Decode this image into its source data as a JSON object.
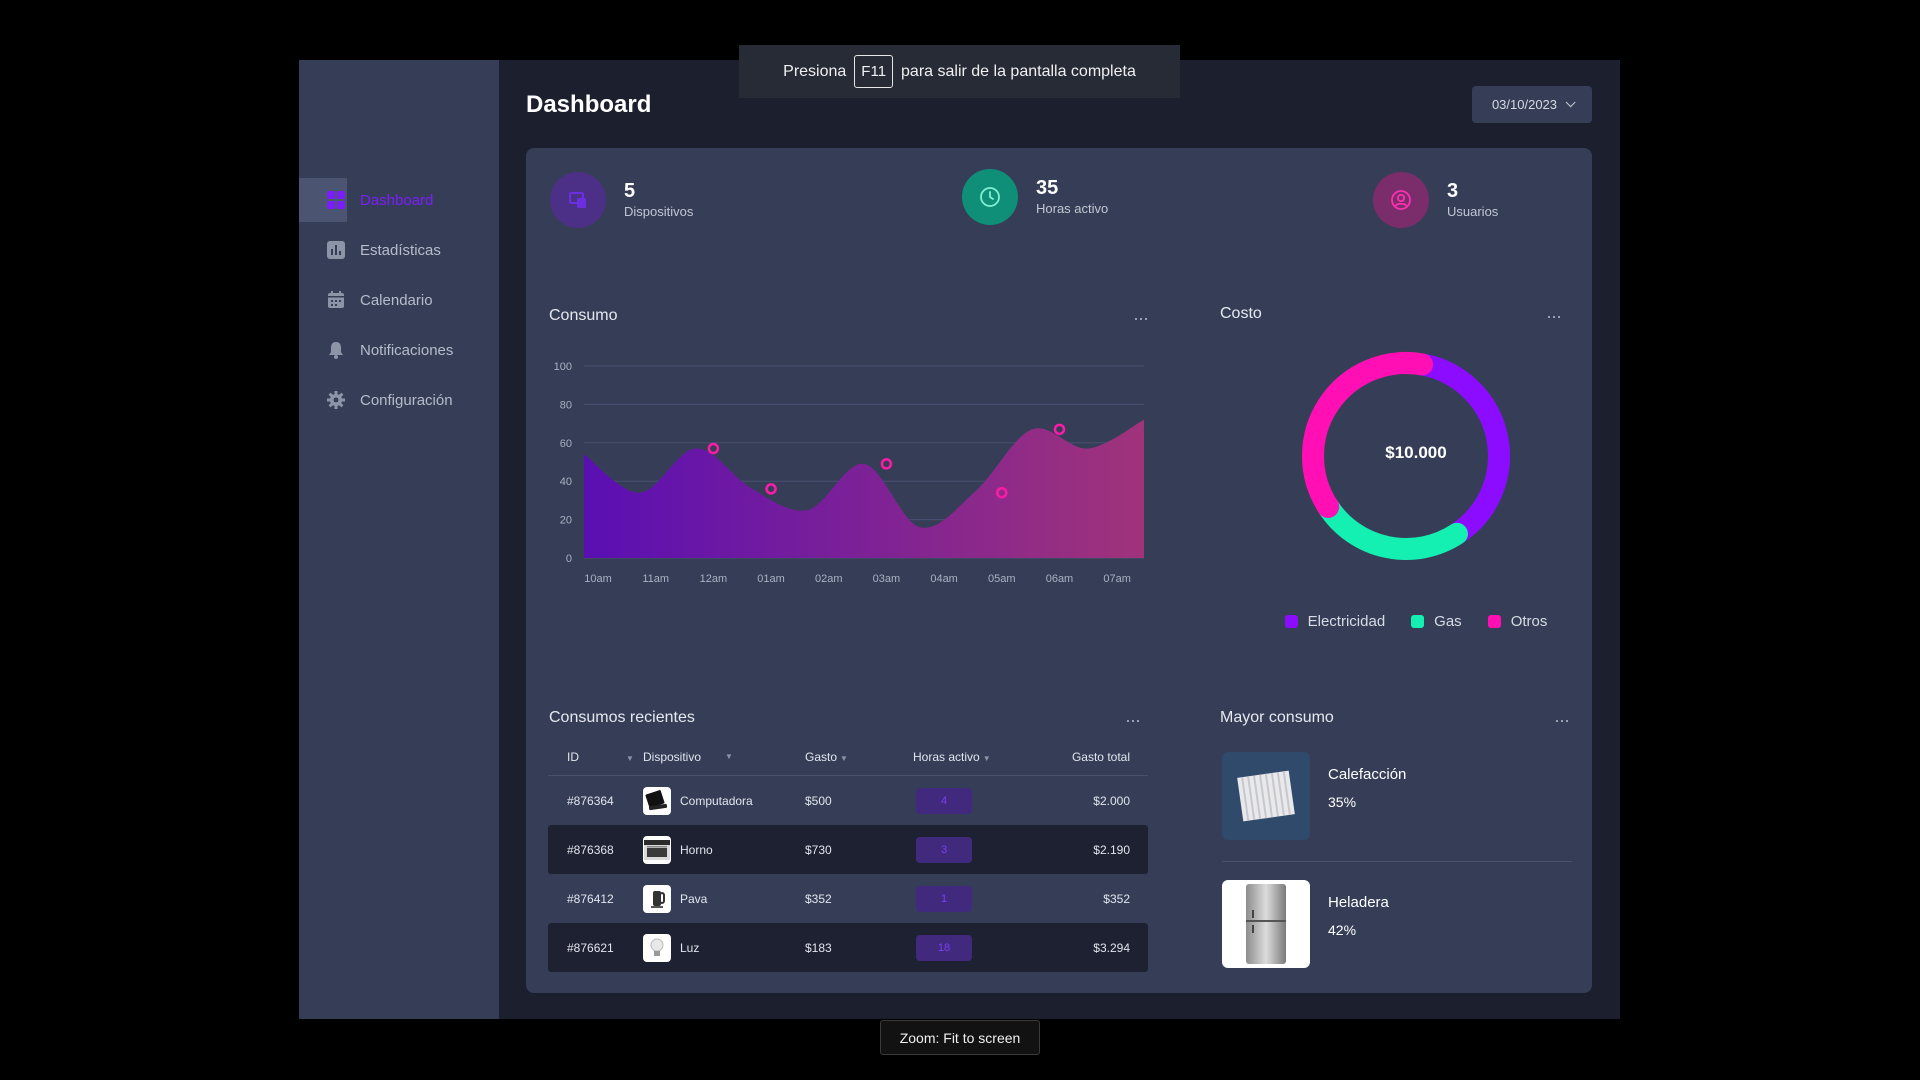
{
  "fullscreen_banner": {
    "before": "Presiona",
    "key": "F11",
    "after": "para salir de la pantalla completa"
  },
  "zoom_toast": "Zoom: Fit to screen",
  "sidebar": {
    "items": [
      {
        "label": "Dashboard",
        "icon": "grid-icon",
        "active": true
      },
      {
        "label": "Estadísticas",
        "icon": "bar-chart-icon",
        "active": false
      },
      {
        "label": "Calendario",
        "icon": "calendar-icon",
        "active": false
      },
      {
        "label": "Notificaciones",
        "icon": "bell-icon",
        "active": false
      },
      {
        "label": "Configuración",
        "icon": "gear-icon",
        "active": false
      }
    ],
    "active_color": "#7b1dfa"
  },
  "header": {
    "title": "Dashboard",
    "date": "03/10/2023"
  },
  "stats": [
    {
      "value": "5",
      "label": "Dispositivos",
      "icon": "devices-icon",
      "color": "#4c2f87"
    },
    {
      "value": "35",
      "label": "Horas activo",
      "icon": "clock-icon",
      "color": "#0f8f78"
    },
    {
      "value": "3",
      "label": "Usuarios",
      "icon": "user-icon",
      "color": "#7a2d6a"
    }
  ],
  "consumo": {
    "title": "Consumo",
    "more": "···"
  },
  "chart_data": [
    {
      "type": "area",
      "title": "Consumo",
      "x": [
        "10am",
        "11am",
        "12am",
        "01am",
        "02am",
        "03am",
        "04am",
        "05am",
        "06am",
        "07am"
      ],
      "y_ticks": [
        "0",
        "20",
        "40",
        "60",
        "80",
        "100"
      ],
      "ylim": [
        0,
        100
      ],
      "series": [
        {
          "values": [
            54,
            34,
            57,
            36,
            25,
            49,
            16,
            35,
            67,
            57,
            72
          ]
        }
      ],
      "markers": [
        {
          "x": "12am",
          "y": 57
        },
        {
          "x": "01am",
          "y": 36
        },
        {
          "x": "03am",
          "y": 49
        },
        {
          "x": "05am",
          "y": 34
        },
        {
          "x": "06am",
          "y": 67
        }
      ],
      "gradient": [
        "#5a0fb3",
        "#a0337a"
      ],
      "marker_color": "#ff1aa8"
    },
    {
      "type": "pie",
      "title": "Costo",
      "center_label": "$10.000",
      "categories": [
        "Electricidad",
        "Gas",
        "Otros"
      ],
      "values": [
        38,
        25,
        37
      ],
      "colors": [
        "#8b0cff",
        "#13f0b2",
        "#ff0fb4"
      ]
    }
  ],
  "costo": {
    "title": "Costo",
    "more": "···"
  },
  "recientes": {
    "title": "Consumos recientes",
    "more": "···",
    "headers": [
      "ID",
      "Dispositivo",
      "Gasto",
      "Horas activo",
      "Gasto total"
    ],
    "rows": [
      {
        "id": "#876364",
        "device": "Computadora",
        "icon": "laptop-icon",
        "gasto": "$500",
        "horas": "4",
        "total": "$2.000"
      },
      {
        "id": "#876368",
        "device": "Horno",
        "icon": "oven-icon",
        "gasto": "$730",
        "horas": "3",
        "total": "$2.190"
      },
      {
        "id": "#876412",
        "device": "Pava",
        "icon": "kettle-icon",
        "gasto": "$352",
        "horas": "1",
        "total": "$352"
      },
      {
        "id": "#876621",
        "device": "Luz",
        "icon": "bulb-icon",
        "gasto": "$183",
        "horas": "18",
        "total": "$3.294"
      }
    ]
  },
  "mayor": {
    "title": "Mayor consumo",
    "more": "···",
    "items": [
      {
        "name": "Calefacción",
        "pct": "35%",
        "icon": "radiator-icon"
      },
      {
        "name": "Heladera",
        "pct": "42%",
        "icon": "fridge-icon"
      }
    ]
  }
}
